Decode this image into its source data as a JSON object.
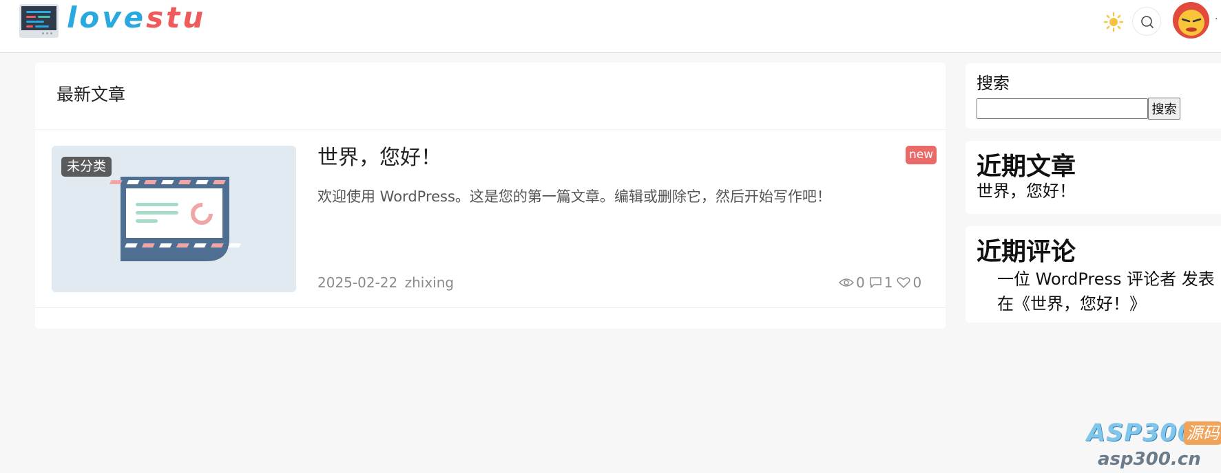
{
  "header": {
    "logo_part1": "love",
    "logo_part2": "stu"
  },
  "main": {
    "section_title": "最新文章",
    "post": {
      "category": "未分类",
      "badge": "new",
      "title": "世界，您好！",
      "excerpt": "欢迎使用 WordPress。这是您的第一篇文章。编辑或删除它，然后开始写作吧！",
      "date": "2025-02-22",
      "author": "zhixing",
      "views": "0",
      "comments": "1",
      "likes": "0"
    }
  },
  "sidebar": {
    "search": {
      "label": "搜索",
      "input_value": "",
      "button_label": "搜索"
    },
    "recent_posts": {
      "title": "近期文章",
      "items": [
        "世界，您好！"
      ]
    },
    "recent_comments": {
      "title": "近期评论",
      "items": [
        "一位 WordPress 评论者 发表在《世界，您好！》"
      ]
    }
  },
  "watermark": {
    "brand": "ASP300",
    "tag": "源码",
    "url": "asp300.cn"
  },
  "colors": {
    "logo_blue": "#29a9e0",
    "logo_red": "#ef5a5a",
    "new_badge": "#ea6a6a"
  }
}
